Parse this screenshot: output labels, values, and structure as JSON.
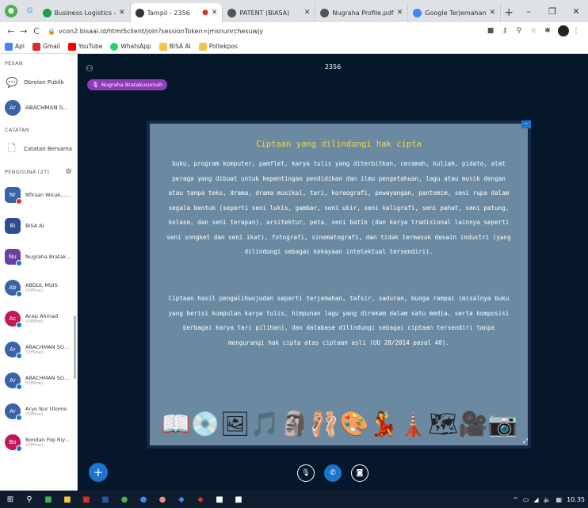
{
  "browser": {
    "tabs": [
      {
        "label": "Business Logistics - benefits",
        "color": "#1a9c4a",
        "active": false
      },
      {
        "label": "Tampil - 2356",
        "color": "#333333",
        "active": true
      },
      {
        "label": "PATENT (BIASA)",
        "color": "#555555",
        "active": false
      },
      {
        "label": "Nugraha Profile.pdf",
        "color": "#555555",
        "active": false
      },
      {
        "label": "Google Terjemahan",
        "color": "#4285f4",
        "active": false
      }
    ],
    "url": "vcon2.bisaai.id/html5client/join?sessionToken=jmsnunrchesuwjy",
    "bookmarks": [
      {
        "label": "Apl",
        "color": "#4285f4"
      },
      {
        "label": "Gmail",
        "color": "#d93025"
      },
      {
        "label": "YouTube",
        "color": "#ff0000"
      },
      {
        "label": "WhatsApp",
        "color": "#25d366"
      },
      {
        "label": "BISA AI",
        "color": "#f6c344"
      },
      {
        "label": "Poltekpos",
        "color": "#f6c344"
      }
    ]
  },
  "sidebar": {
    "section_messages": "PESAN",
    "public_chat": "Obrolan Publik",
    "pinned_user": "ABACHMAN SOLEMA...",
    "section_notes": "CATATAN",
    "shared_notes": "Catatan Bersama",
    "section_users": "PENGGUNA (27)",
    "users": [
      {
        "name": "Nfirsan Wicak... (Anda)",
        "sub": "",
        "initials": "Nr",
        "color": "#3a62a8",
        "square": true,
        "dot": "red"
      },
      {
        "name": "BISA AI",
        "sub": "",
        "initials": "Bi",
        "color": "#2e4e8f",
        "square": true,
        "dot": ""
      },
      {
        "name": "Nugraha Bratakusu...",
        "sub": "",
        "initials": "Nu",
        "color": "#6b3fa0",
        "square": true,
        "dot": "blue"
      },
      {
        "name": "ABDUL MUIS",
        "sub": "(Offline)",
        "initials": "Ab",
        "color": "#3a62a8",
        "square": false,
        "dot": "blue"
      },
      {
        "name": "Acep Ahmad",
        "sub": "(Offline)",
        "initials": "Ac",
        "color": "#c2185b",
        "square": false,
        "dot": "blue"
      },
      {
        "name": "ABACHMAN SOLEM...",
        "sub": "(Offline)",
        "initials": "Ar",
        "color": "#3a62a8",
        "square": false,
        "dot": "blue"
      },
      {
        "name": "ABACHMAN SOLEM...",
        "sub": "(Offline)",
        "initials": "Ar",
        "color": "#3a62a8",
        "square": false,
        "dot": "blue"
      },
      {
        "name": "Aryo Nur Utomo",
        "sub": "(Offline)",
        "initials": "Ar",
        "color": "#3a62a8",
        "square": false,
        "dot": "blue"
      },
      {
        "name": "Bondan Fiqi Riyalda",
        "sub": "(Offline)",
        "initials": "Bo",
        "color": "#c2185b",
        "square": false,
        "dot": "blue"
      }
    ]
  },
  "main": {
    "room": "2356",
    "presenter": "Nugraha Bratakusumah",
    "slide": {
      "title": "Ciptaan yang dilindungi hak cipta",
      "paragraph1": "buku, program komputer, pamflet, karya tulis yang diterbitkan, ceramah, kuliah, pidato, alat peraga yang dibuat untuk kepentingan pendidikan dan ilmu pengetahuan, lagu atau musik dengan atau tanpa teks, drama, drama musikal, tari, koreografi, pewayangan, pantomim, seni rupa dalam segala bentuk (seperti seni lukis, gambar, seni ukir, seni kaligrafi, seni pahat, seni patung, kolase, dan seni terapan), arsitektur, peta, seni batik (dan karya tradisional lainnya seperti seni songket dan seni ikat), fotografi, sinematografi, dan tidak termasuk desain industri (yang dilindungi sebagai kekayaan intelektual tersendiri).",
      "paragraph2": "Ciptaan hasil pengalihwujudan seperti terjemahan, tafsir, saduran, bunga rampai (misalnya buku yang berisi kumpulan karya tulis, himpunan lagu yang direkam dalam satu media, serta komposisi berbagai karya tari pilihan), dan database dilindungi sebagai ciptaan tersendiri tanpa mengurangi hak cipta atas ciptaan asli (UU 28/2014 pasal 40).",
      "icons": [
        "📖",
        "💿",
        "🖼",
        "🎵",
        "🗿",
        "🩰",
        "🎨",
        "💃",
        "🗼",
        "🗺",
        "🎥",
        "📷"
      ]
    }
  },
  "taskbar": {
    "time": "10.35"
  }
}
